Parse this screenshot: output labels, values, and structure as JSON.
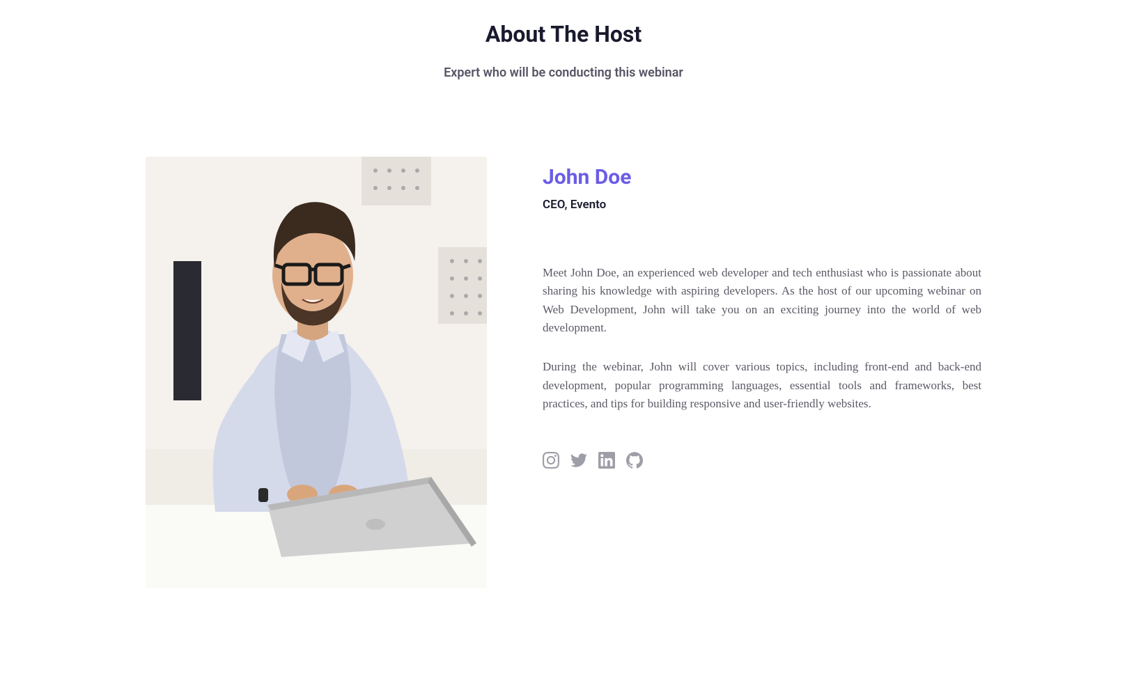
{
  "header": {
    "title": "About The Host",
    "subtitle": "Expert who will be conducting this webinar"
  },
  "host": {
    "name": "John Doe",
    "title": "CEO, Evento",
    "bio_p1": "Meet John Doe, an experienced web developer and tech enthusiast who is passionate about sharing his knowledge with aspiring developers. As the host of our upcoming webinar on Web Development, John will take you on an exciting journey into the world of web development.",
    "bio_p2": "During the webinar, John will cover various topics, including front-end and back-end development, popular programming languages, essential tools and frameworks, best practices, and tips for building responsive and user-friendly websites."
  },
  "social": {
    "instagram": "instagram",
    "twitter": "twitter",
    "linkedin": "linkedin",
    "github": "github"
  }
}
